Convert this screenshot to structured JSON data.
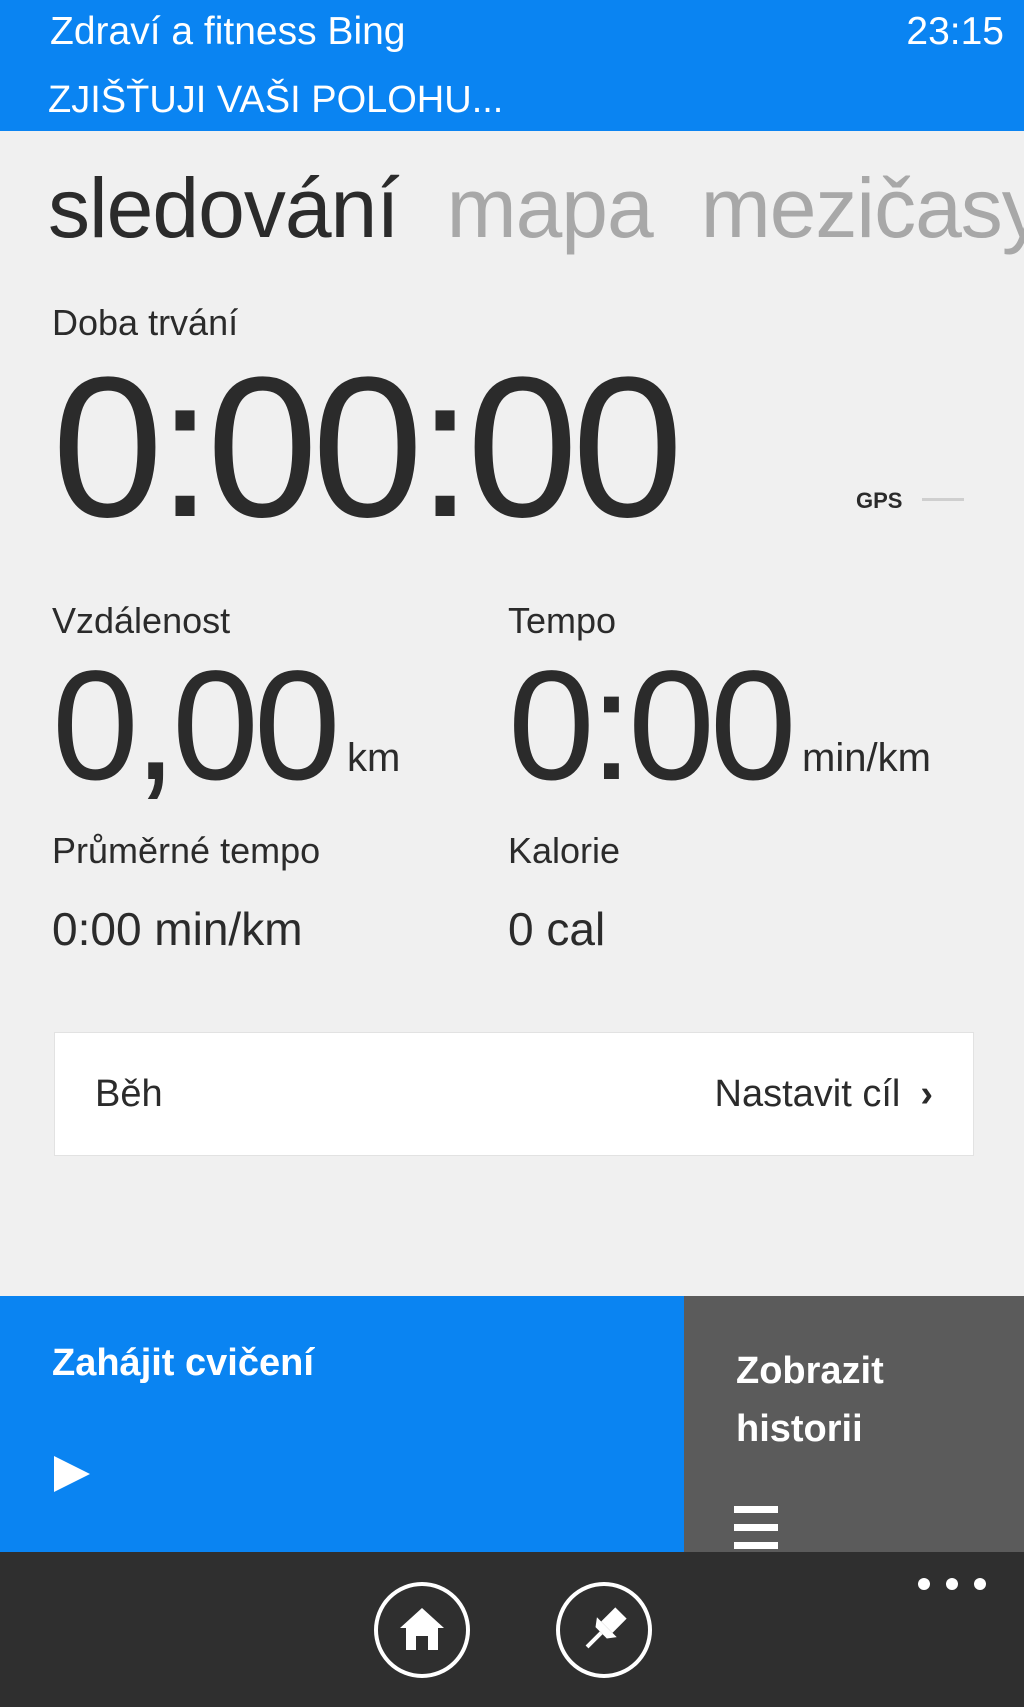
{
  "status_bar": {
    "app_title": "Zdraví a fitness Bing",
    "time": "23:15"
  },
  "location_bar": {
    "text": "ZJIŠŤUJI VAŠI POLOHU..."
  },
  "pivot": {
    "tabs": [
      {
        "label": "sledování",
        "active": true
      },
      {
        "label": "mapa",
        "active": false
      },
      {
        "label": "mezičasy",
        "active": false
      }
    ]
  },
  "tracking": {
    "duration_label": "Doba trvání",
    "duration_value": "0:00:00",
    "gps_label": "GPS",
    "distance_label": "Vzdálenost",
    "distance_value": "0,00",
    "distance_unit": "km",
    "pace_label": "Tempo",
    "pace_value": "0:00",
    "pace_unit": "min/km",
    "avg_pace_label": "Průměrné tempo",
    "avg_pace_value": "0:00 min/km",
    "calories_label": "Kalorie",
    "calories_value": "0 cal"
  },
  "activity": {
    "type": "Běh",
    "goal_label": "Nastavit cíl",
    "chevron": "›"
  },
  "tiles": {
    "start_label": "Zahájit cvičení",
    "history_label": "Zobrazit historii"
  },
  "icons": {
    "play": "play-icon",
    "list": "list-icon",
    "home": "home-icon",
    "pin": "pin-icon",
    "more": "more-icon",
    "chevron": "chevron-right-icon"
  },
  "colors": {
    "accent": "#0a84f2",
    "history_tile": "#5b5b5b",
    "app_bar": "#2f2f2f",
    "background": "#f0f0f0"
  }
}
